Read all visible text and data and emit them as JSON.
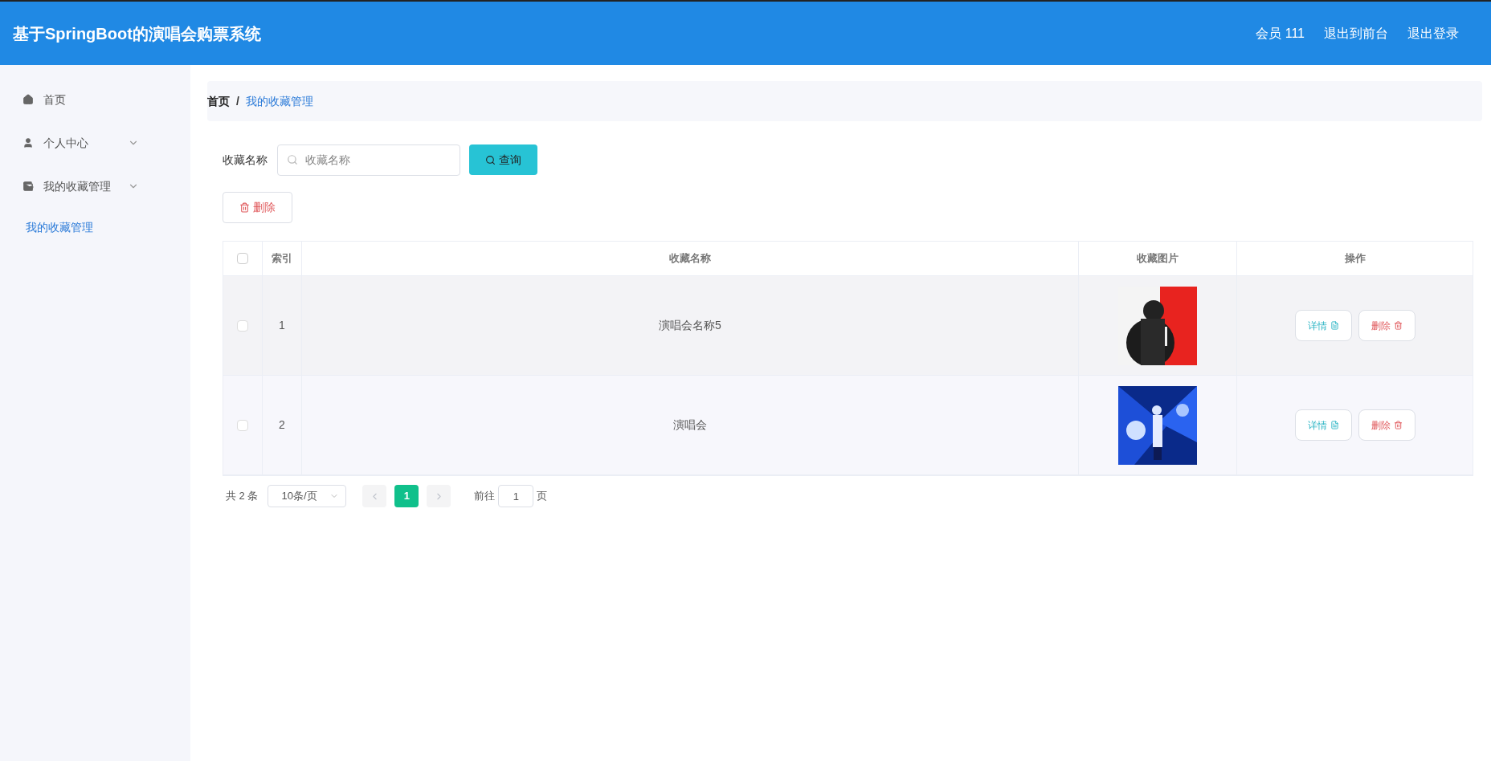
{
  "header": {
    "title": "基于SpringBoot的演唱会购票系统",
    "links": [
      "会员 111",
      "退出到前台",
      "退出登录"
    ]
  },
  "sidebar": {
    "items": [
      {
        "label": "首页",
        "kind": "link"
      },
      {
        "label": "个人中心",
        "kind": "menu"
      },
      {
        "label": "我的收藏管理",
        "kind": "menu",
        "children": [
          {
            "label": "我的收藏管理",
            "selected": true
          }
        ]
      }
    ]
  },
  "breadcrumb": [
    {
      "label": "首页",
      "current": false
    },
    {
      "label": "我的收藏管理",
      "current": true
    }
  ],
  "separator": "/",
  "search": {
    "label": "收藏名称",
    "placeholder": "收藏名称",
    "button": "查询"
  },
  "delete_button": "删除",
  "table": {
    "header_checked": false,
    "columns": [
      "索引",
      "收藏名称",
      "收藏图片",
      "操作"
    ],
    "rows": [
      {
        "checked": false,
        "index": "1",
        "name": "演唱会名称5",
        "picture": {
          "kind": "picture"
        },
        "actions": [
          "详情",
          "删除"
        ]
      },
      {
        "checked": false,
        "index": "2",
        "name": "演唱会",
        "picture": {
          "kind": "picture"
        },
        "actions": [
          "详情",
          "删除"
        ]
      }
    ]
  },
  "pagination": {
    "total": "共 2 条",
    "page_size": "10条/页",
    "pages": [
      {
        "label": "1",
        "selected": true
      }
    ],
    "prev_disabled": true,
    "next_disabled": true,
    "goto_label": "前往",
    "goto_value": "1",
    "goto_suffix": "页"
  }
}
